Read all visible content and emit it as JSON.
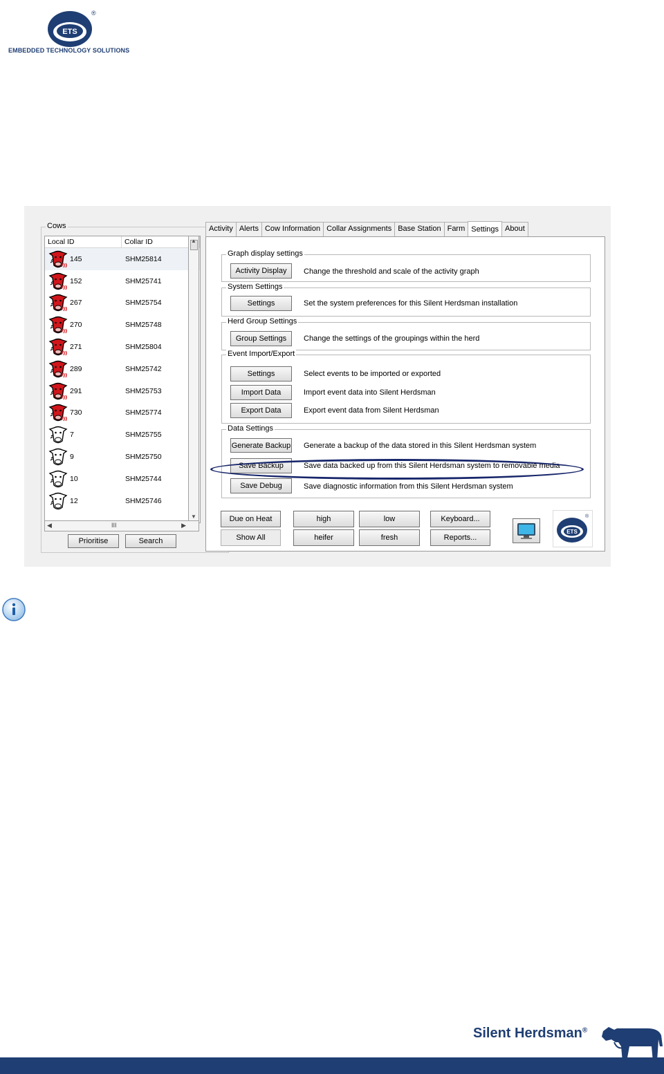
{
  "header": {
    "brand_caption": "EMBEDDED TECHNOLOGY SOLUTIONS",
    "logo_text": "ETS",
    "registered": "®"
  },
  "cows_panel": {
    "title": "Cows",
    "columns": [
      "Local ID",
      "Collar ID"
    ],
    "rows": [
      {
        "local_id": "145",
        "collar_id": "SHM25814",
        "status": "red"
      },
      {
        "local_id": "152",
        "collar_id": "SHM25741",
        "status": "red"
      },
      {
        "local_id": "267",
        "collar_id": "SHM25754",
        "status": "red"
      },
      {
        "local_id": "270",
        "collar_id": "SHM25748",
        "status": "red"
      },
      {
        "local_id": "271",
        "collar_id": "SHM25804",
        "status": "red"
      },
      {
        "local_id": "289",
        "collar_id": "SHM25742",
        "status": "red"
      },
      {
        "local_id": "291",
        "collar_id": "SHM25753",
        "status": "red"
      },
      {
        "local_id": "730",
        "collar_id": "SHM25774",
        "status": "red"
      },
      {
        "local_id": "7",
        "collar_id": "SHM25755",
        "status": "white"
      },
      {
        "local_id": "9",
        "collar_id": "SHM25750",
        "status": "white"
      },
      {
        "local_id": "10",
        "collar_id": "SHM25744",
        "status": "white"
      },
      {
        "local_id": "12",
        "collar_id": "SHM25746",
        "status": "white"
      }
    ],
    "hscroll_glyph": "III",
    "prioritise_label": "Prioritise",
    "search_label": "Search"
  },
  "tabs": [
    "Activity",
    "Alerts",
    "Cow Information",
    "Collar Assignments",
    "Base Station",
    "Farm",
    "Settings",
    "About"
  ],
  "active_tab": "Settings",
  "settings": {
    "graph": {
      "title": "Graph display settings",
      "button": "Activity Display",
      "desc": "Change the threshold and scale of the activity graph"
    },
    "system": {
      "title": "System Settings",
      "button": "Settings",
      "desc": "Set the system preferences for this Silent Herdsman installation"
    },
    "herd": {
      "title": "Herd Group Settings",
      "button": "Group Settings",
      "desc": "Change the settings of the groupings within the herd"
    },
    "events": {
      "title": "Event Import/Export",
      "settings_button": "Settings",
      "settings_desc": "Select events to be imported or exported",
      "import_button": "Import Data",
      "import_desc": "Import event data into Silent Herdsman",
      "export_button": "Export Data",
      "export_desc": "Export event data from Silent Herdsman"
    },
    "data": {
      "title": "Data Settings",
      "generate_button": "Generate Backup",
      "generate_desc": "Generate a backup of the data stored in this Silent Herdsman system",
      "save_button": "Save Backup",
      "save_desc": "Save data backed up from this Silent Herdsman system to removable media",
      "debug_button": "Save Debug",
      "debug_desc": "Save diagnostic information from this Silent Herdsman system"
    }
  },
  "filters": {
    "due_on_heat": "Due on Heat",
    "show_all": "Show All",
    "high": "high",
    "heifer": "heifer",
    "low": "low",
    "fresh": "fresh",
    "keyboard": "Keyboard...",
    "reports": "Reports..."
  },
  "footer": {
    "brand": "Silent Herdsman",
    "registered": "®"
  },
  "colors": {
    "brand_blue": "#1f3e73",
    "highlight_ring": "#17266a",
    "alert_cow": "#d0161b"
  }
}
